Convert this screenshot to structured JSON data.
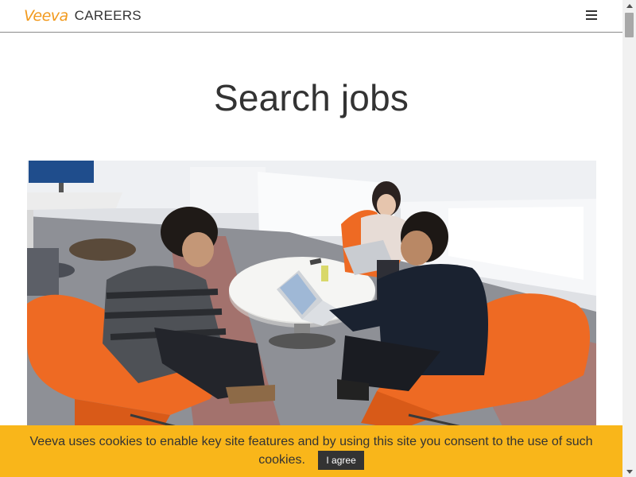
{
  "header": {
    "brand": "Veeva",
    "section": "CAREERS",
    "menu_icon": "hamburger-menu-icon"
  },
  "main": {
    "title": "Search jobs",
    "hero_image": "photo of four people working on laptops in orange lounge chairs around a white table"
  },
  "cookie_banner": {
    "message": "Veeva uses cookies to enable key site features and by using this site you consent to the use of such cookies.",
    "agree_label": "I agree",
    "background": "#f9b61a"
  },
  "colors": {
    "brand_orange": "#f29a1e",
    "text": "#333333",
    "button_dark": "#333333"
  }
}
